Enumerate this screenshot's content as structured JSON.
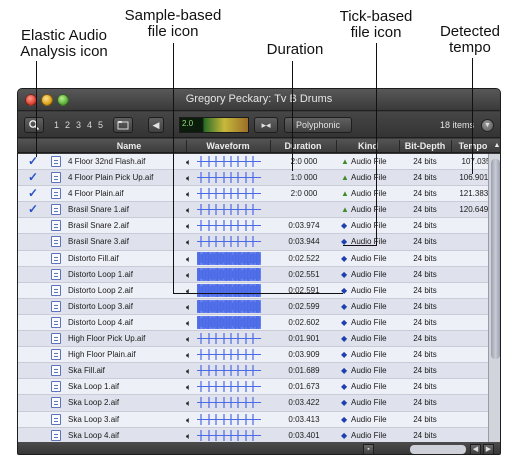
{
  "callouts": {
    "elastic": "Elastic Audio\nAnalysis icon",
    "sample": "Sample-based\nfile icon",
    "duration": "Duration",
    "tick": "Tick-based\nfile icon",
    "tempo": "Detected\ntempo"
  },
  "window": {
    "title": "Gregory Peckary: Tv B Drums",
    "item_count": "18 items"
  },
  "toolbar": {
    "numbers": [
      "1",
      "2",
      "3",
      "4",
      "5"
    ],
    "meter_value": "2.0",
    "mode": "Polyphonic"
  },
  "columns": {
    "name": "Name",
    "waveform": "Waveform",
    "duration": "Duration",
    "kind": "Kind",
    "bitdepth": "Bit-Depth",
    "tempo": "Tempo"
  },
  "colors": {
    "accent_check": "#2b50c8",
    "waveform": "#4a6ae6",
    "row_even": "#eef0f7",
    "row_odd": "#dfe2ec",
    "kind_sample": "#3c8d2c",
    "kind_tick": "#1f3fae"
  },
  "rows": [
    {
      "analyzed": true,
      "name": "4 Floor 32nd Flash.aif",
      "waveform": "hits",
      "duration": "2:0 000",
      "kind_icon": "sample-based-file-icon",
      "kind": "Audio File",
      "bitdepth": "24 bits",
      "tempo": "107.035"
    },
    {
      "analyzed": true,
      "name": "4 Floor Plain Pick Up.aif",
      "waveform": "hits",
      "duration": "1:0 000",
      "kind_icon": "sample-based-file-icon",
      "kind": "Audio File",
      "bitdepth": "24 bits",
      "tempo": "106.9015"
    },
    {
      "analyzed": true,
      "name": "4 Floor Plain.aif",
      "waveform": "hits",
      "duration": "2:0 000",
      "kind_icon": "sample-based-file-icon",
      "kind": "Audio File",
      "bitdepth": "24 bits",
      "tempo": "121.3838"
    },
    {
      "analyzed": true,
      "name": "Brasil Snare 1.aif",
      "waveform": "hits",
      "duration": "",
      "kind_icon": "sample-based-file-icon",
      "kind": "Audio File",
      "bitdepth": "24 bits",
      "tempo": "120.6497"
    },
    {
      "analyzed": false,
      "name": "Brasil Snare 2.aif",
      "waveform": "hits",
      "duration": "0:03.974",
      "kind_icon": "tick-based-file-icon",
      "kind": "Audio File",
      "bitdepth": "24 bits",
      "tempo": ""
    },
    {
      "analyzed": false,
      "name": "Brasil Snare 3.aif",
      "waveform": "hits",
      "duration": "0:03.944",
      "kind_icon": "tick-based-file-icon",
      "kind": "Audio File",
      "bitdepth": "24 bits",
      "tempo": ""
    },
    {
      "analyzed": false,
      "name": "Distorto Fill.aif",
      "waveform": "dense",
      "duration": "0:02.522",
      "kind_icon": "tick-based-file-icon",
      "kind": "Audio File",
      "bitdepth": "24 bits",
      "tempo": ""
    },
    {
      "analyzed": false,
      "name": "Distorto Loop 1.aif",
      "waveform": "dense",
      "duration": "0:02.551",
      "kind_icon": "tick-based-file-icon",
      "kind": "Audio File",
      "bitdepth": "24 bits",
      "tempo": ""
    },
    {
      "analyzed": false,
      "name": "Distorto Loop 2.aif",
      "waveform": "dense",
      "duration": "0:02.591",
      "kind_icon": "tick-based-file-icon",
      "kind": "Audio File",
      "bitdepth": "24 bits",
      "tempo": ""
    },
    {
      "analyzed": false,
      "name": "Distorto Loop 3.aif",
      "waveform": "dense",
      "duration": "0:02.599",
      "kind_icon": "tick-based-file-icon",
      "kind": "Audio File",
      "bitdepth": "24 bits",
      "tempo": ""
    },
    {
      "analyzed": false,
      "name": "Distorto Loop 4.aif",
      "waveform": "dense",
      "duration": "0:02.602",
      "kind_icon": "tick-based-file-icon",
      "kind": "Audio File",
      "bitdepth": "24 bits",
      "tempo": ""
    },
    {
      "analyzed": false,
      "name": "High Floor Pick Up.aif",
      "waveform": "hits",
      "duration": "0:01.901",
      "kind_icon": "tick-based-file-icon",
      "kind": "Audio File",
      "bitdepth": "24 bits",
      "tempo": ""
    },
    {
      "analyzed": false,
      "name": "High Floor Plain.aif",
      "waveform": "hits",
      "duration": "0:03.909",
      "kind_icon": "tick-based-file-icon",
      "kind": "Audio File",
      "bitdepth": "24 bits",
      "tempo": ""
    },
    {
      "analyzed": false,
      "name": "Ska Fill.aif",
      "waveform": "hits",
      "duration": "0:01.689",
      "kind_icon": "tick-based-file-icon",
      "kind": "Audio File",
      "bitdepth": "24 bits",
      "tempo": ""
    },
    {
      "analyzed": false,
      "name": "Ska Loop 1.aif",
      "waveform": "hits",
      "duration": "0:01.673",
      "kind_icon": "tick-based-file-icon",
      "kind": "Audio File",
      "bitdepth": "24 bits",
      "tempo": ""
    },
    {
      "analyzed": false,
      "name": "Ska Loop 2.aif",
      "waveform": "hits",
      "duration": "0:03.422",
      "kind_icon": "tick-based-file-icon",
      "kind": "Audio File",
      "bitdepth": "24 bits",
      "tempo": ""
    },
    {
      "analyzed": false,
      "name": "Ska Loop 3.aif",
      "waveform": "hits",
      "duration": "0:03.413",
      "kind_icon": "tick-based-file-icon",
      "kind": "Audio File",
      "bitdepth": "24 bits",
      "tempo": ""
    },
    {
      "analyzed": false,
      "name": "Ska Loop 4.aif",
      "waveform": "hits",
      "duration": "0:03.401",
      "kind_icon": "tick-based-file-icon",
      "kind": "Audio File",
      "bitdepth": "24 bits",
      "tempo": ""
    }
  ]
}
